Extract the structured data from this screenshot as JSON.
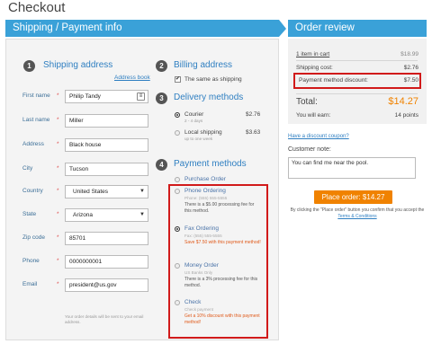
{
  "page": {
    "title": "Checkout"
  },
  "headers": {
    "left": "Shipping / Payment info",
    "right": "Order review"
  },
  "shipping": {
    "number": "1",
    "title": "Shipping address",
    "address_book_link": "Address book",
    "fields": [
      {
        "label": "First name",
        "value": "Philip Tandy"
      },
      {
        "label": "Last name",
        "value": "Miller"
      },
      {
        "label": "Address",
        "value": "Black house"
      },
      {
        "label": "City",
        "value": "Tucson"
      },
      {
        "label": "Country",
        "value": "United States"
      },
      {
        "label": "State",
        "value": "Arizona"
      },
      {
        "label": "Zip code",
        "value": "85701"
      },
      {
        "label": "Phone",
        "value": "0000000001"
      },
      {
        "label": "Email",
        "value": "president@us.gov"
      }
    ],
    "required_mark": "*",
    "email_note": "Your order details will be sent to your email address."
  },
  "billing": {
    "number": "2",
    "title": "Billing address",
    "same_as_shipping": "The same as shipping",
    "check_mark": "✔"
  },
  "delivery": {
    "number": "3",
    "title": "Delivery methods",
    "options": [
      {
        "name": "Courier",
        "sub": "2 - 4 days",
        "price": "$2.76",
        "selected": true
      },
      {
        "name": "Local shipping",
        "sub": "up to one week",
        "price": "$3.63",
        "selected": false
      }
    ]
  },
  "payment": {
    "number": "4",
    "title": "Payment methods",
    "options": [
      {
        "name": "Purchase Order",
        "sub": "",
        "note": "",
        "note_color": "#555555",
        "selected": false
      },
      {
        "name": "Phone Ordering",
        "sub": "Phone: (555) 555-5555",
        "note": "There is a $5.00 processing fee for this method.",
        "note_color": "#555555",
        "selected": false
      },
      {
        "name": "Fax Ordering",
        "sub": "Fax: (555) 555-5555",
        "note": "Save $7.50 with this payment method!",
        "note_color": "#e05a1a",
        "selected": true
      },
      {
        "name": "Money Order",
        "sub": "US Banks Only",
        "note": "There is a 3% processing fee for this method.",
        "note_color": "#555555",
        "selected": false
      },
      {
        "name": "Check",
        "sub": "Check payment",
        "note": "Get a 10% discount with this payment method!",
        "note_color": "#e05a1a",
        "selected": false
      }
    ]
  },
  "review": {
    "items_link": "1 item in cart",
    "items_value": "$18.99",
    "shipping_label": "Shipping cost:",
    "shipping_value": "$2.76",
    "discount_label": "Payment method discount:",
    "discount_value": "$7.50",
    "total_label": "Total:",
    "total_value": "$14.27",
    "earn_label": "You will earn:",
    "earn_value": "14 points",
    "coupon_link": "Have a discount coupon?",
    "customer_note_label": "Customer note:",
    "customer_note_value": "You can find me near the pool.",
    "place_order": "Place order: $14.27",
    "confirm_prefix": "By clicking the \"Place order\" button you confirm that you accept the",
    "terms_link": "Terms & Conditions"
  },
  "colors": {
    "accent": "#3aa1d8",
    "link": "#2f7fc1",
    "orange": "#f08200",
    "highlight": "#d11a1a"
  }
}
